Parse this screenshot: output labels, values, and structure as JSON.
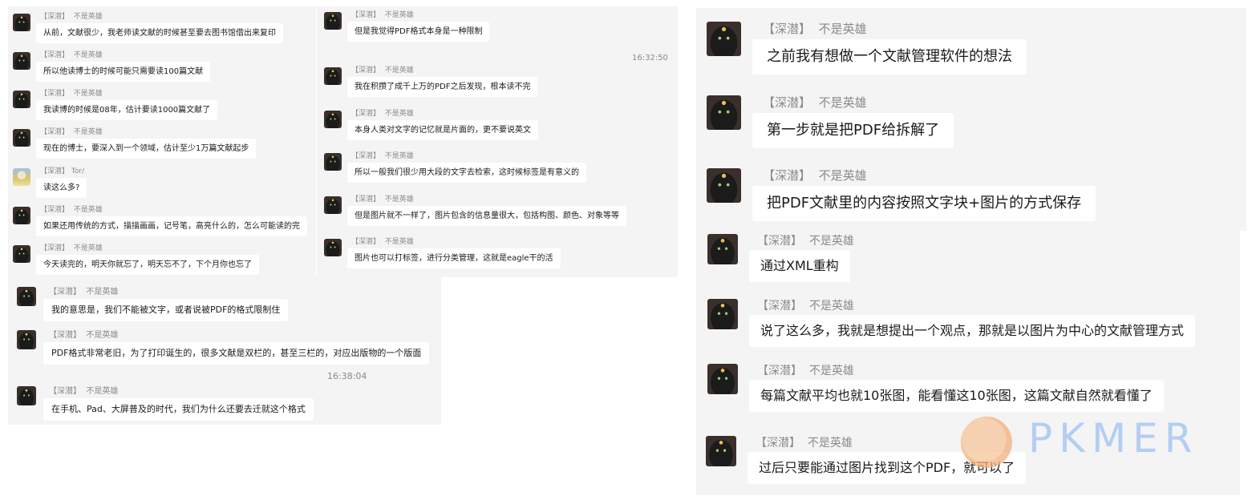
{
  "meta": {
    "group": "【深潜】",
    "user": "不是英雄",
    "other_user": "Tor/"
  },
  "panel_a": [
    "从前，文献很少，我老师读文献的时候甚至要去图书馆借出来复印",
    "所以他读博士的时候可能只需要读100篇文献",
    "我读博的时候是08年，估计要读1000篇文献了",
    "现在的博士，要深入到一个领域，估计至少1万篇文献起步",
    "读这么多?",
    "如果还用传统的方式，描描画画，记号笔，高亮什么的，怎么可能读的完",
    "今天读完的，明天你就忘了，明天忘不了，下个月你也忘了"
  ],
  "panel_b": [
    "但是我觉得PDF格式本身是一种限制",
    "我在积攒了成千上万的PDF之后发现，根本读不完",
    "本身人类对文字的记忆就是片面的，更不要说英文",
    "所以一般我们很少用大段的文字去检索，这时候标签是有意义的",
    "但是图片就不一样了，图片包含的信息量很大，包括构图、颜色、对象等等",
    "图片也可以打标签，进行分类管理，这就是eagle干的活"
  ],
  "panel_c": [
    "我的意思是，我们不能被文字，或者说被PDF的格式限制住",
    "PDF格式非常老旧，为了打印诞生的，很多文献是双栏的，甚至三栏的，对应出版物的一个版面",
    "在手机、Pad、大屏普及的时代，我们为什么还要去迁就这个格式"
  ],
  "panel_d": [
    "之前我有想做一个文献管理软件的想法",
    "第一步就是把PDF给拆解了",
    "把PDF文献里的内容按照文字块+图片的方式保存"
  ],
  "panel_e": [
    "通过XML重构",
    "说了这么多，我就是想提出一个观点，那就是以图片为中心的文献管理方式",
    "每篇文献平均也就10张图，能看懂这10张图，这篇文献自然就看懂了",
    "过后只要能通过图片找到这个PDF，就可以了"
  ],
  "timestamps": {
    "t1": "16:32:50",
    "t2": "16:38:04"
  },
  "watermark": "PKMER"
}
